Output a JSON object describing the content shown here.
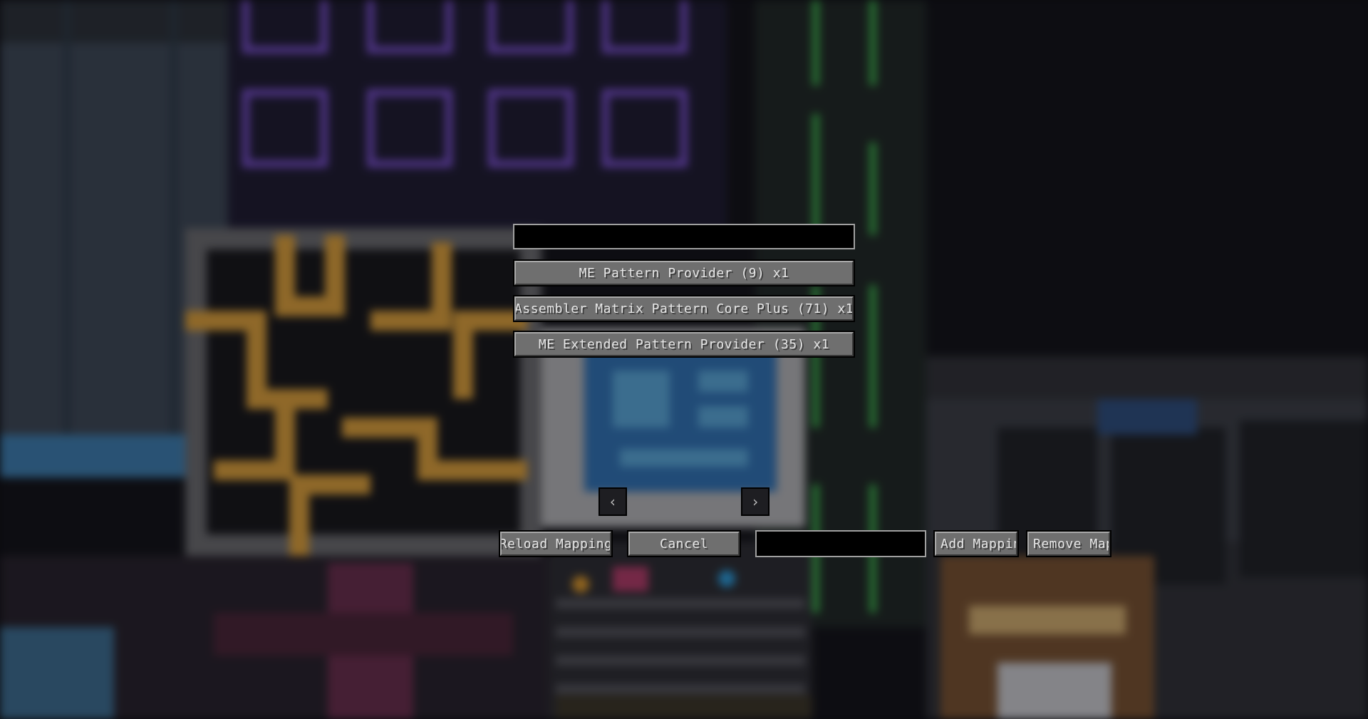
{
  "search": {
    "value": ""
  },
  "mappings": [
    {
      "label": "ME Pattern Provider  (9)  x1"
    },
    {
      "label": "Assembler Matrix Pattern Core Plus  (71)  x1"
    },
    {
      "label": "ME Extended Pattern Provider  (35)  x1"
    }
  ],
  "pager": {
    "prev_icon": "‹",
    "next_icon": "›"
  },
  "toolbar": {
    "reload_label": "Reload Mapping",
    "cancel_label": "Cancel",
    "mapping_input_value": "",
    "add_label": "Add Mapping",
    "remove_label": "Remove Map"
  },
  "colors": {
    "button_face": "#6f6f6f",
    "field_bg": "#000000",
    "field_border": "#a0a0a0",
    "text": "#e6e6e6"
  }
}
